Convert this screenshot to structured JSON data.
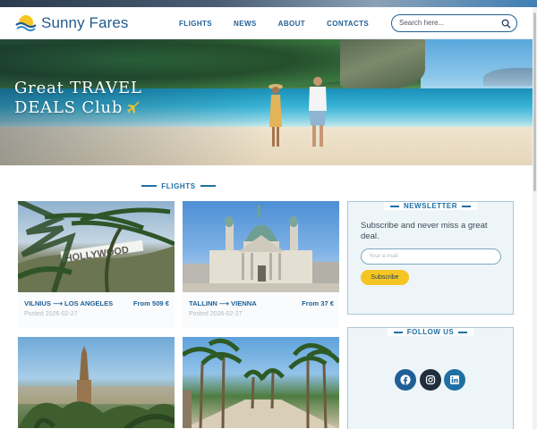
{
  "site": {
    "logo_text": "Sunny Fares"
  },
  "nav": {
    "items": [
      "FLIGHTS",
      "NEWS",
      "ABOUT",
      "CONTACTS"
    ]
  },
  "search": {
    "placeholder": "Search here..."
  },
  "hero": {
    "line1": "Great  TRAVEL",
    "line2": "DEALS Club"
  },
  "flights": {
    "section_title": "FLIGHTS",
    "cards": [
      {
        "route": "VILNIUS ⟶ LOS ANGELES",
        "price": "From 509 €",
        "posted": "Posted 2026-02-27",
        "image": "hollywood-sign"
      },
      {
        "route": "TALLINN ⟶ VIENNA",
        "price": "From 37 €",
        "posted": "Posted 2026-02-27",
        "image": "karlskirche-vienna"
      },
      {
        "route": "",
        "price": "",
        "posted": "",
        "image": "barcelona-sagrada"
      },
      {
        "route": "",
        "price": "",
        "posted": "",
        "image": "palm-promenade"
      }
    ]
  },
  "newsletter": {
    "title": "NEWSLETTER",
    "description": "Subscribe and never miss a great deal.",
    "email_placeholder": "Your e-mail",
    "subscribe_label": "Subscribe"
  },
  "follow": {
    "title": "FOLLOW US",
    "socials": [
      {
        "name": "facebook",
        "color": "#1f5f95"
      },
      {
        "name": "instagram",
        "color": "#1f2d3d"
      },
      {
        "name": "linkedin",
        "color": "#1f6fa5"
      }
    ]
  },
  "colors": {
    "brand": "#1f5f95",
    "accent": "#f5c523"
  }
}
